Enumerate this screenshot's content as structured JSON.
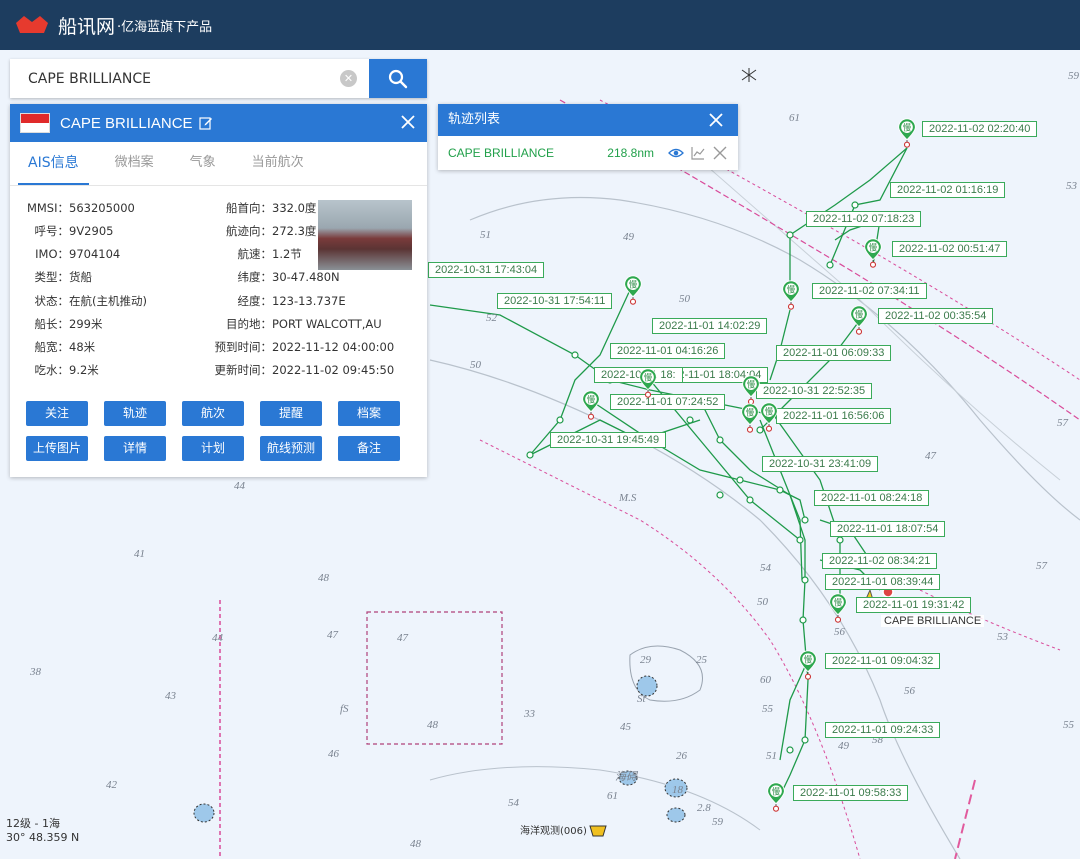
{
  "brand": {
    "name": "船讯网",
    "tagline": "·亿海蓝旗下产品"
  },
  "search": {
    "value": "CAPE BRILLIANCE"
  },
  "ship": {
    "name": "CAPE BRILLIANCE",
    "tabs": [
      "AIS信息",
      "微档案",
      "气象",
      "当前航次"
    ],
    "left": [
      {
        "k": "MMSI：",
        "v": "563205000"
      },
      {
        "k": "呼号：",
        "v": "9V2905"
      },
      {
        "k": "IMO：",
        "v": "9704104"
      },
      {
        "k": "类型：",
        "v": "货船"
      },
      {
        "k": "状态：",
        "v": "在航(主机推动)"
      },
      {
        "k": "船长：",
        "v": "299米"
      },
      {
        "k": "船宽：",
        "v": "48米"
      },
      {
        "k": "吃水：",
        "v": "9.2米"
      }
    ],
    "right": [
      {
        "k": "船首向：",
        "v": "332.0度"
      },
      {
        "k": "航迹向：",
        "v": "272.3度"
      },
      {
        "k": "航速：",
        "v": "1.2节"
      },
      {
        "k": "纬度：",
        "v": "30-47.480N"
      },
      {
        "k": "经度：",
        "v": "123-13.737E"
      },
      {
        "k": "目的地：",
        "v": "PORT WALCOTT,AU"
      },
      {
        "k": "预到时间：",
        "v": "2022-11-12 04:00:00"
      },
      {
        "k": "更新时间：",
        "v": "2022-11-02 09:45:50"
      }
    ],
    "buttons": [
      "关注",
      "轨迹",
      "航次",
      "提醒",
      "档案",
      "上传图片",
      "详情",
      "计划",
      "航线预测",
      "备注"
    ]
  },
  "track_list": {
    "title": "轨迹列表",
    "entries": [
      {
        "name": "CAPE BRILLIANCE",
        "distance": "218.8nm"
      }
    ]
  },
  "map": {
    "slow_marker": "慢",
    "track_labels": [
      "2022-11-02 02:20:40",
      "2022-11-02 01:16:19",
      "2022-11-02 07:18:23",
      "2022-11-02 00:51:47",
      "2022-11-02 07:34:11",
      "2022-11-02 00:35:54",
      "2022-11-01 14:02:29",
      "2022-11-01 04:16:26",
      "2022-11-01 06:09:33",
      "2022-11-01 18:04:04",
      "2022-10-31 22:52:35",
      "2022-11-01 07:24:52",
      "2022-11-01 16:56:06",
      "2022-10-31 19:45:49",
      "2022-10-31 23:41:09",
      "2022-11-01 08:24:18",
      "2022-11-01 18:07:54",
      "2022-11-02 08:34:21",
      "2022-11-01 08:39:44",
      "2022-11-01 19:31:42",
      "2022-11-01 09:04:32",
      "2022-11-01 09:24:33",
      "2022-11-01 09:58:33",
      "2022-10-31 17:43:04",
      "2022-10-31 17:54:11",
      "2022-10-31 18:"
    ],
    "ship_label": "CAPE BRILLIANCE",
    "depths": [
      "61",
      "51",
      "49",
      "50",
      "52",
      "50",
      "53",
      "59",
      "44",
      "41",
      "48",
      "47",
      "47",
      "44",
      "38",
      "43",
      "fS",
      "48",
      "33",
      "45",
      "46",
      "42",
      "29",
      "25",
      "26",
      "54",
      "56",
      "50",
      "53",
      "57",
      "55",
      "56",
      "58",
      "47",
      "61",
      "54",
      "59",
      "60",
      "55",
      "49",
      "51",
      "57",
      "48",
      "M.S",
      "St"
    ],
    "scale": "12级 - 1海",
    "coordinate": "30° 48.359 N",
    "observation": "海洋观测(006)",
    "chart_notes": [
      "海碍",
      "18",
      "2.8"
    ]
  }
}
